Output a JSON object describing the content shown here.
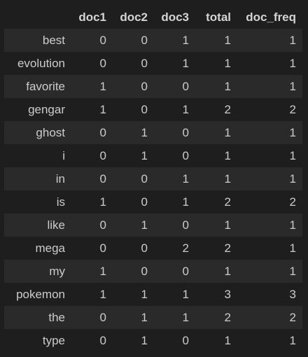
{
  "table": {
    "index_header": "",
    "columns": [
      "doc1",
      "doc2",
      "doc3",
      "total",
      "doc_freq"
    ],
    "rows": [
      {
        "label": "best",
        "values": [
          "0",
          "0",
          "1",
          "1",
          "1"
        ]
      },
      {
        "label": "evolution",
        "values": [
          "0",
          "0",
          "1",
          "1",
          "1"
        ]
      },
      {
        "label": "favorite",
        "values": [
          "1",
          "0",
          "0",
          "1",
          "1"
        ]
      },
      {
        "label": "gengar",
        "values": [
          "1",
          "0",
          "1",
          "2",
          "2"
        ]
      },
      {
        "label": "ghost",
        "values": [
          "0",
          "1",
          "0",
          "1",
          "1"
        ]
      },
      {
        "label": "i",
        "values": [
          "0",
          "1",
          "0",
          "1",
          "1"
        ]
      },
      {
        "label": "in",
        "values": [
          "0",
          "0",
          "1",
          "1",
          "1"
        ]
      },
      {
        "label": "is",
        "values": [
          "1",
          "0",
          "1",
          "2",
          "2"
        ]
      },
      {
        "label": "like",
        "values": [
          "0",
          "1",
          "0",
          "1",
          "1"
        ]
      },
      {
        "label": "mega",
        "values": [
          "0",
          "0",
          "2",
          "2",
          "1"
        ]
      },
      {
        "label": "my",
        "values": [
          "1",
          "0",
          "0",
          "1",
          "1"
        ]
      },
      {
        "label": "pokemon",
        "values": [
          "1",
          "1",
          "1",
          "3",
          "3"
        ]
      },
      {
        "label": "the",
        "values": [
          "0",
          "1",
          "1",
          "2",
          "2"
        ]
      },
      {
        "label": "type",
        "values": [
          "0",
          "1",
          "0",
          "1",
          "1"
        ]
      }
    ]
  },
  "colors": {
    "background": "#1e1e1e",
    "stripe_row": "#2a2a2a",
    "text": "#cccccc",
    "header_text": "#d4d4d4"
  }
}
